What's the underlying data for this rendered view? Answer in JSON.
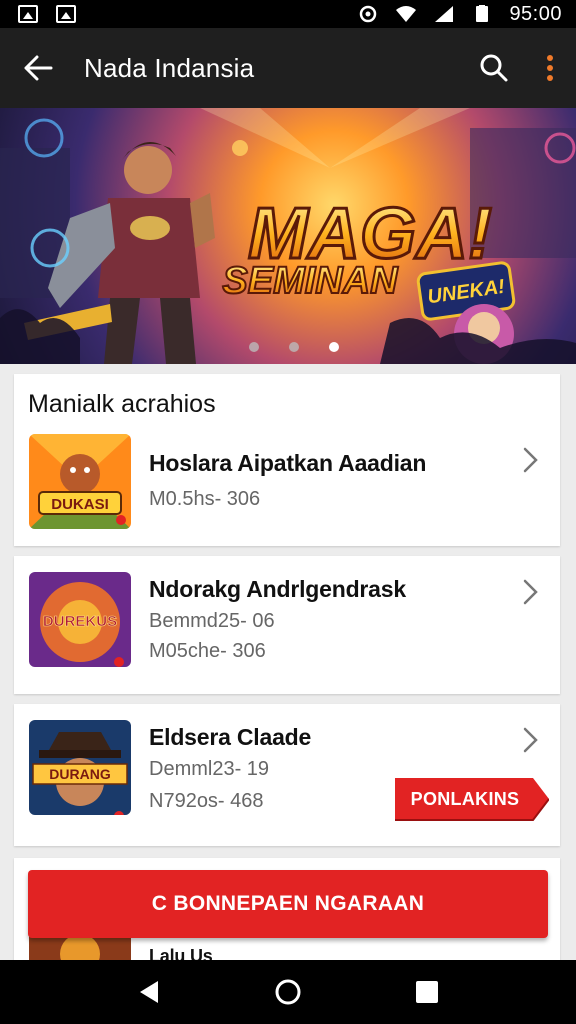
{
  "status_bar": {
    "time": "95:00"
  },
  "app_bar": {
    "title": "Nada  Indansia"
  },
  "banner": {
    "headline": "MAGA!",
    "subhead": "SEMINAN",
    "badge": "UNEKA!",
    "slide_count": 3,
    "active_slide": 3
  },
  "section": {
    "header": "Manialk acrahios"
  },
  "games": [
    {
      "title": "Hoslara Aipatkan Aaadian",
      "lines": [
        "M0.5hs- 306"
      ],
      "thumb_text": "DUKASI"
    },
    {
      "title": "Ndorakg Andrlgendrask",
      "lines": [
        "Bemmd25- 06",
        "M05che- 306"
      ],
      "thumb_text": "DUREKUS"
    },
    {
      "title": "Eldsera Claade",
      "lines": [
        "Demml23- 19",
        "N792os- 468"
      ],
      "thumb_text": "DURANG"
    }
  ],
  "promo_tag": {
    "label": "PONLAKINS"
  },
  "cta": {
    "label": "C BONNEPAEN NGARAAN"
  },
  "partial_card": {
    "title": "Lalu Us"
  },
  "colors": {
    "accent": "#e22323",
    "app_bar": "#1f1f1f",
    "menu_dots": "#f07a2a"
  }
}
